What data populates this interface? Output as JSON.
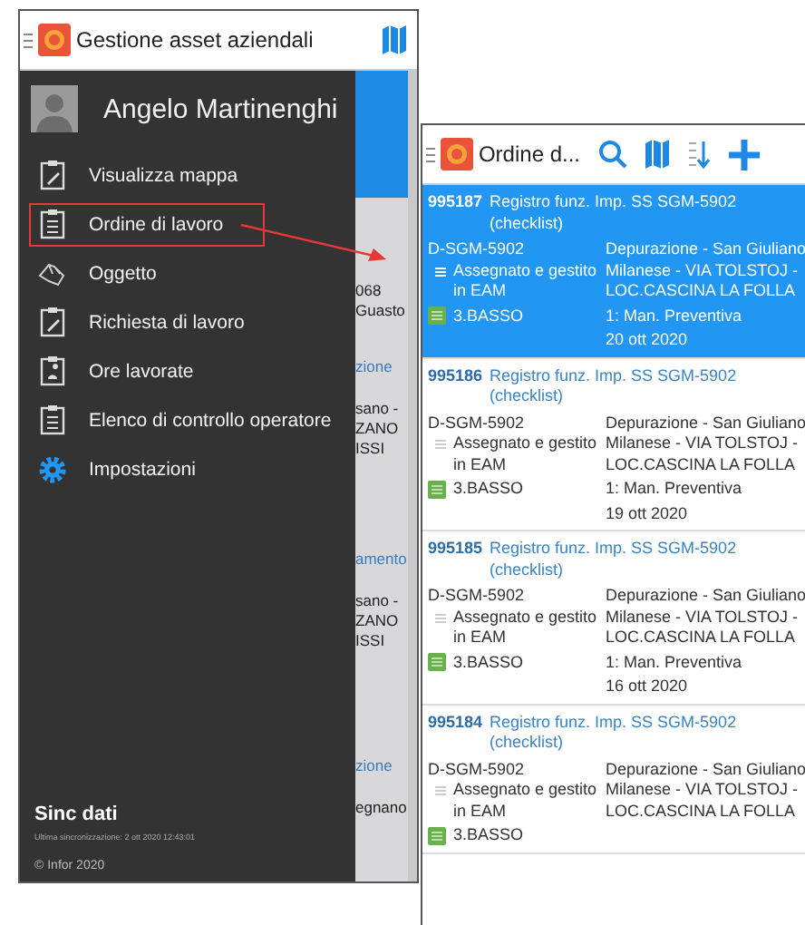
{
  "left_screen": {
    "app_bar": {
      "title": "Gestione asset aziendali"
    },
    "background_fragments": [
      "068",
      "Guasto",
      "zione",
      "sano -",
      "ZANO",
      "ISSI",
      "amento",
      "sano -",
      "ZANO",
      "ISSI",
      "zione",
      "egnano"
    ],
    "drawer": {
      "user_name": "Angelo Martinenghi",
      "items": [
        {
          "label": "Visualizza mappa",
          "highlighted": false
        },
        {
          "label": "Ordine di lavoro",
          "highlighted": true
        },
        {
          "label": "Oggetto",
          "highlighted": false
        },
        {
          "label": "Richiesta di lavoro",
          "highlighted": false
        },
        {
          "label": "Ore lavorate",
          "highlighted": false
        },
        {
          "label": "Elenco di controllo operatore",
          "highlighted": false
        },
        {
          "label": "Impostazioni",
          "highlighted": false
        }
      ],
      "sync_title": "Sinc dati",
      "sync_detail": "Ultima sincronizzazione: 2 ott 2020 12:43:01",
      "copyright": "© Infor 2020"
    }
  },
  "right_screen": {
    "app_bar": {
      "title": "Ordine d..."
    },
    "orders": [
      {
        "id": "995187",
        "title": "Registro funz. Imp. SS SGM-5902",
        "subtitle": "(checklist)",
        "equipment": "D-SGM-5902",
        "status": "Assegnato e gestito in EAM",
        "priority": "3.BASSO",
        "location": "Depurazione - San Giuliano Milanese - VIA TOLSTOJ - LOC.CASCINA LA FOLLA",
        "type": "1: Man. Preventiva",
        "date": "20 ott 2020",
        "selected": true
      },
      {
        "id": "995186",
        "title": "Registro funz. Imp. SS SGM-5902",
        "subtitle": "(checklist)",
        "equipment": "D-SGM-5902",
        "status": "Assegnato e gestito in EAM",
        "priority": "3.BASSO",
        "location": "Depurazione - San Giuliano Milanese - VIA TOLSTOJ - LOC.CASCINA LA FOLLA",
        "type": "1: Man. Preventiva",
        "date": "19 ott 2020",
        "selected": false
      },
      {
        "id": "995185",
        "title": "Registro funz. Imp. SS SGM-5902",
        "subtitle": "(checklist)",
        "equipment": "D-SGM-5902",
        "status": "Assegnato e gestito in EAM",
        "priority": "3.BASSO",
        "location": "Depurazione - San Giuliano Milanese - VIA TOLSTOJ - LOC.CASCINA LA FOLLA",
        "type": "1: Man. Preventiva",
        "date": "16 ott 2020",
        "selected": false
      },
      {
        "id": "995184",
        "title": "Registro funz. Imp. SS SGM-5902",
        "subtitle": "(checklist)",
        "equipment": "D-SGM-5902",
        "status": "Assegnato e gestito in EAM",
        "priority": "3.BASSO",
        "location": "Depurazione - San Giuliano Milanese - VIA TOLSTOJ - LOC.CASCINA LA FOLLA",
        "selected": false
      }
    ]
  }
}
